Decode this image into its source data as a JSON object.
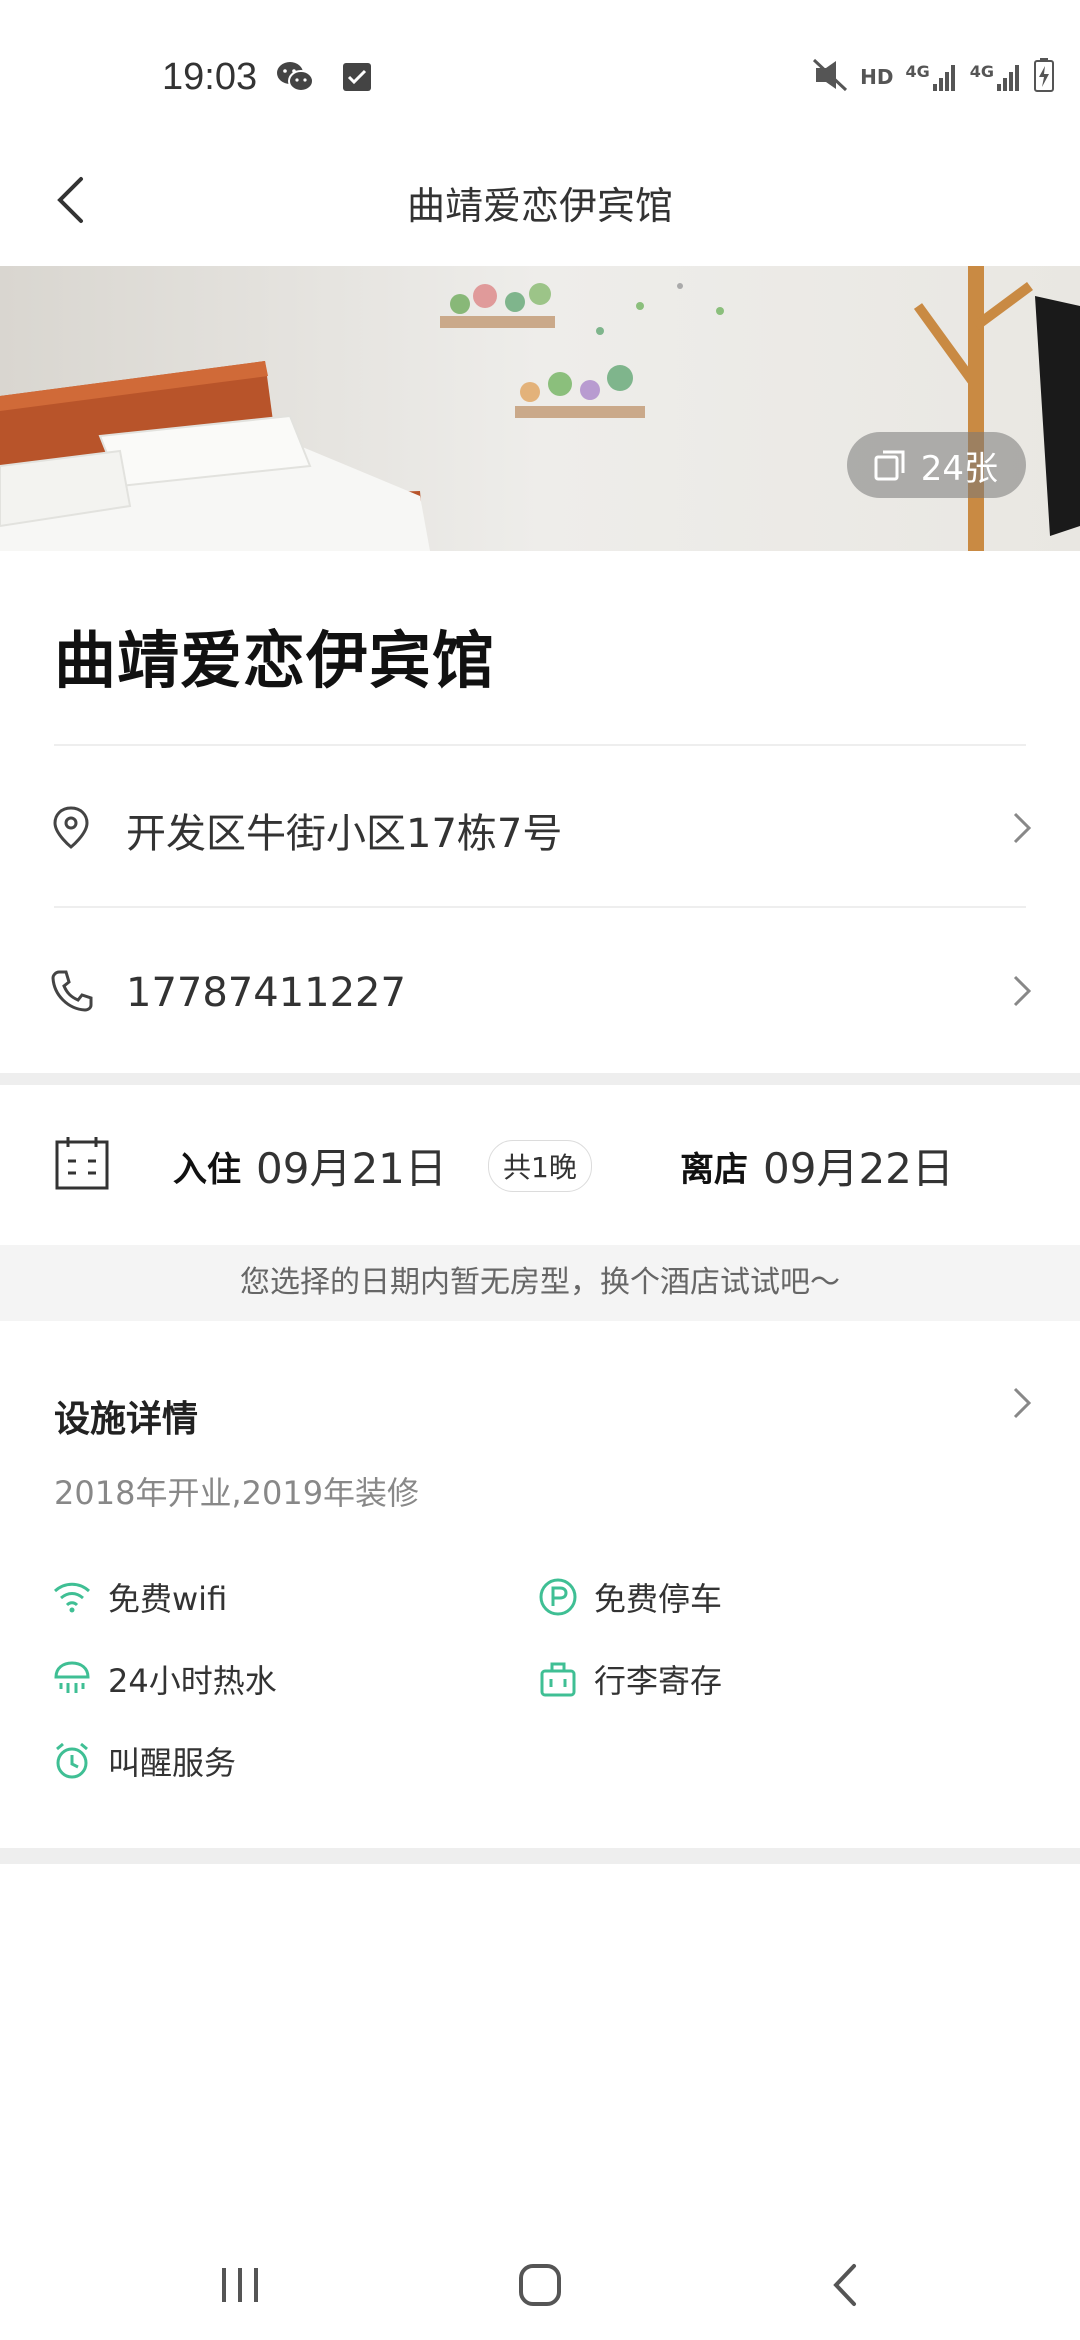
{
  "status_bar": {
    "time": "19:03",
    "left_icons": [
      "wechat-icon",
      "checkbox-icon"
    ],
    "right_icons": [
      "mute-vibrate-icon",
      "hd-icon",
      "4g-signal-icon",
      "4g-signal-icon",
      "battery-charging-icon"
    ],
    "hd_label": "HD",
    "net_label": "4G"
  },
  "nav": {
    "title": "曲靖爱恋伊宾馆"
  },
  "hero": {
    "photo_count": "24张"
  },
  "hotel": {
    "name": "曲靖爱恋伊宾馆",
    "address": "开发区牛街小区17栋7号",
    "phone": "17787411227"
  },
  "dates": {
    "checkin_label": "入住",
    "checkin_date": "09月21日",
    "nights": "共1晚",
    "checkout_label": "离店",
    "checkout_date": "09月22日"
  },
  "notice": "您选择的日期内暂无房型，换个酒店试试吧～",
  "facilities": {
    "title": "设施详情",
    "subtitle": "2018年开业,2019年装修",
    "items": [
      {
        "label": "免费wifi",
        "icon": "wifi-icon"
      },
      {
        "label": "免费停车",
        "icon": "parking-icon"
      },
      {
        "label": "24小时热水",
        "icon": "shower-icon"
      },
      {
        "label": "行李寄存",
        "icon": "luggage-icon"
      },
      {
        "label": "叫醒服务",
        "icon": "alarm-clock-icon"
      }
    ]
  },
  "colors": {
    "accent": "#3fbf94",
    "divider": "#eeeeee",
    "notice_bg": "#f4f4f4"
  }
}
